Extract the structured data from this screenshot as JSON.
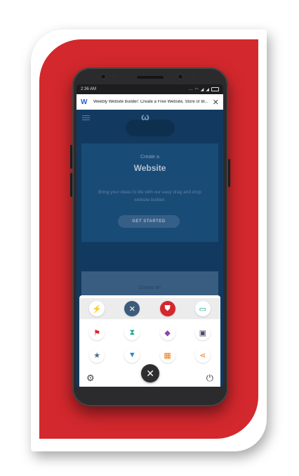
{
  "status_bar": {
    "time": "2:36 AM"
  },
  "notification": {
    "logo": "W",
    "text": "Weebly Website Builder: Create a Free Website, Store or Bl...",
    "close_glyph": "✕"
  },
  "website": {
    "logo": "ω",
    "subtitle": "Create a",
    "headline": "Website",
    "blurb": "Bring your ideas to life with our easy drag and drop website builder.",
    "cta_label": "GET STARTED",
    "card_label": "Create an"
  },
  "launcher": {
    "rows": [
      [
        {
          "icon": "lightning-icon",
          "glyph": "⚡",
          "color": "#f5a623",
          "bg": "#ffffff"
        },
        {
          "icon": "crosshair-icon",
          "glyph": "✕",
          "color": "#ffffff",
          "bg": "#3c5a7a"
        },
        {
          "icon": "shield-icon",
          "glyph": "⛊",
          "color": "#ffffff",
          "bg": "#d3282d"
        },
        {
          "icon": "monitor-icon",
          "glyph": "▭",
          "color": "#17a589",
          "bg": "#ffffff"
        }
      ],
      [
        {
          "icon": "flag-icon",
          "glyph": "⚑",
          "color": "#d3282d",
          "bg": "#ffffff"
        },
        {
          "icon": "hourglass-icon",
          "glyph": "⧗",
          "color": "#17a589",
          "bg": "#ffffff"
        },
        {
          "icon": "gem-icon",
          "glyph": "◆",
          "color": "#8e44ad",
          "bg": "#ffffff"
        },
        {
          "icon": "floppy-icon",
          "glyph": "▣",
          "color": "#4a4a6a",
          "bg": "#ffffff"
        }
      ],
      [
        {
          "icon": "star-icon",
          "glyph": "★",
          "color": "#4a6a8a",
          "bg": "#ffffff"
        },
        {
          "icon": "tshirt-icon",
          "glyph": "▼",
          "color": "#2e86c1",
          "bg": "#ffffff"
        },
        {
          "icon": "qr-icon",
          "glyph": "▦",
          "color": "#e67e22",
          "bg": "#ffffff"
        },
        {
          "icon": "share-icon",
          "glyph": "⋖",
          "color": "#e67e22",
          "bg": "#ffffff"
        }
      ]
    ],
    "settings_glyph": "⚙",
    "close_glyph": "✕",
    "power_glyph": "⏻"
  }
}
